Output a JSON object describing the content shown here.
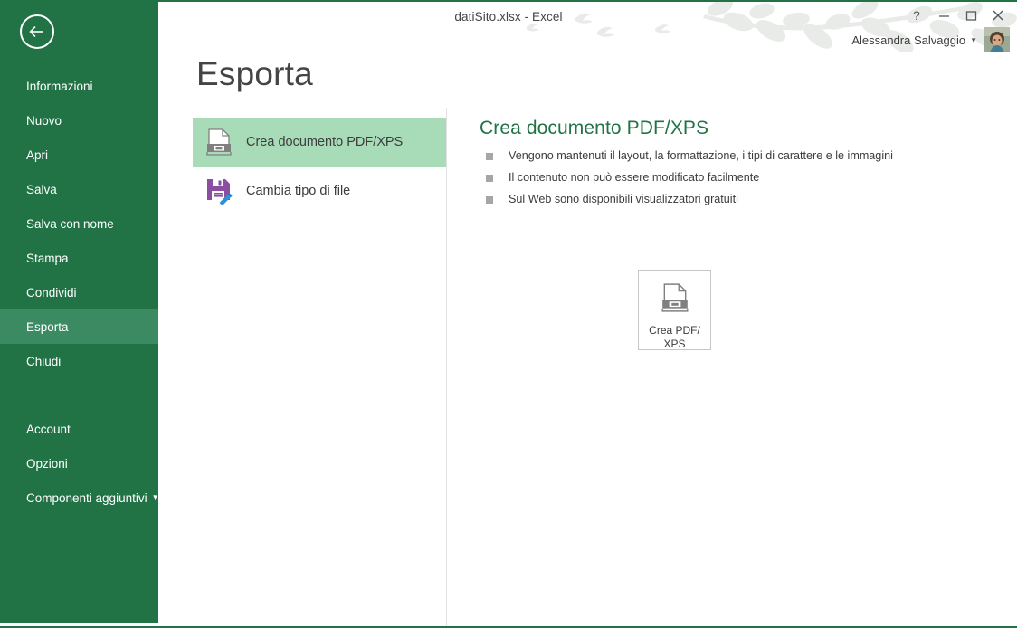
{
  "window": {
    "title": "datiSito.xlsx - Excel",
    "controls": {
      "help_label": "?",
      "minimize_label": "Riduci a icona",
      "maximize_label": "Ingrandisci",
      "close_label": "Chiudi"
    },
    "account": {
      "name": "Alessandra Salvaggio",
      "caret": "▼"
    }
  },
  "colors": {
    "brand_green": "#217346",
    "sidebar_selected": "#3b8a62",
    "option_selected": "#a8dcb9",
    "accent_heading": "#217346",
    "icon_purple": "#8b4f9f",
    "icon_blue": "#2f8fd8",
    "bullet_gray": "#a6a6a6"
  },
  "sidebar": {
    "back_label": "Indietro",
    "items": [
      {
        "label": "Informazioni",
        "selected": false,
        "caret": ""
      },
      {
        "label": "Nuovo",
        "selected": false,
        "caret": ""
      },
      {
        "label": "Apri",
        "selected": false,
        "caret": ""
      },
      {
        "label": "Salva",
        "selected": false,
        "caret": ""
      },
      {
        "label": "Salva con nome",
        "selected": false,
        "caret": ""
      },
      {
        "label": "Stampa",
        "selected": false,
        "caret": ""
      },
      {
        "label": "Condividi",
        "selected": false,
        "caret": ""
      },
      {
        "label": "Esporta",
        "selected": true,
        "caret": ""
      },
      {
        "label": "Chiudi",
        "selected": false,
        "caret": ""
      }
    ],
    "items_secondary": [
      {
        "label": "Account",
        "selected": false,
        "caret": ""
      },
      {
        "label": "Opzioni",
        "selected": false,
        "caret": ""
      },
      {
        "label": "Componenti aggiuntivi",
        "selected": false,
        "caret": "▼"
      }
    ]
  },
  "main": {
    "page_title": "Esporta",
    "options": [
      {
        "label": "Crea documento PDF/XPS",
        "icon": "pdf-document-icon",
        "selected": true
      },
      {
        "label": "Cambia tipo di file",
        "icon": "save-file-type-icon",
        "selected": false
      }
    ],
    "detail": {
      "title": "Crea documento PDF/XPS",
      "bullets": [
        "Vengono mantenuti il layout, la formattazione, i tipi di carattere e le immagini",
        "Il contenuto non può essere modificato facilmente",
        "Sul Web sono disponibili visualizzatori gratuiti"
      ],
      "action_button": {
        "label": "Crea PDF/\nXPS",
        "icon": "pdf-document-icon"
      }
    }
  }
}
